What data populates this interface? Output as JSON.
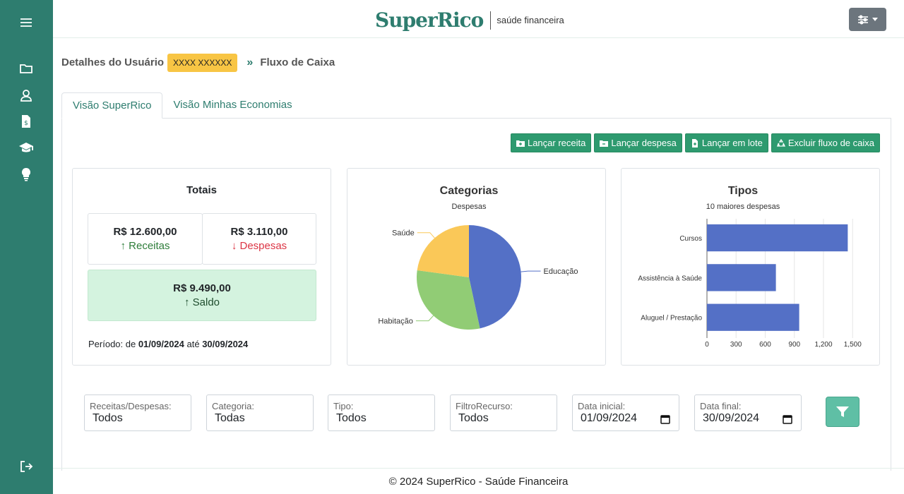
{
  "header": {
    "logo_text": "SuperRico",
    "logo_sub": "saúde financeira"
  },
  "breadcrumb": {
    "user_label": "Detalhes do Usuário",
    "user_name": "XXXX XXXXXX",
    "arrow": "»",
    "current": "Fluxo de Caixa"
  },
  "tabs": [
    {
      "label": "Visão SuperRico"
    },
    {
      "label": "Visão Minhas Economias"
    }
  ],
  "actions": [
    {
      "label": "Lançar receita"
    },
    {
      "label": "Lançar despesa"
    },
    {
      "label": "Lançar em lote"
    },
    {
      "label": "Excluir fluxo de caixa"
    }
  ],
  "totals": {
    "title": "Totais",
    "receitas_value": "R$ 12.600,00",
    "receitas_label": "↑ Receitas",
    "despesas_value": "R$ 3.110,00",
    "despesas_label": "↓ Despesas",
    "saldo_value": "R$ 9.490,00",
    "saldo_label": "↑ Saldo",
    "periodo_prefix": "Período: de ",
    "periodo_start": "01/09/2024",
    "periodo_mid": " até ",
    "periodo_end": "30/09/2024"
  },
  "colors": {
    "sidebar": "#2e7d6f",
    "accent": "#2e7d6f",
    "receita": "#2e7d3a",
    "despesa": "#dc3545",
    "saldo_bg": "#d4f3df",
    "bar": "#5470c6"
  },
  "chart_data": [
    {
      "type": "pie",
      "title": "Categorias",
      "subtitle": "Despesas",
      "labels": [
        "Educação",
        "Habitação",
        "Saúde"
      ],
      "values": [
        1450,
        950,
        710
      ],
      "colors": [
        "#5470c6",
        "#91cc75",
        "#fac858"
      ]
    },
    {
      "type": "bar",
      "orientation": "horizontal",
      "title": "Tipos",
      "subtitle": "10 maiores despesas",
      "categories": [
        "Cursos",
        "Assistência à Saúde",
        "Aluguel / Prestação"
      ],
      "values": [
        1450,
        710,
        950
      ],
      "xlim": [
        0,
        1600
      ],
      "xticks": [
        0,
        300,
        600,
        900,
        1200,
        1500
      ],
      "xtick_labels": [
        "0",
        "300",
        "600",
        "900",
        "1,200",
        "1,500"
      ],
      "color": "#5470c6"
    }
  ],
  "filters": [
    {
      "label": "Receitas/Despesas:",
      "value": "Todos"
    },
    {
      "label": "Categoria:",
      "value": "Todas"
    },
    {
      "label": "Tipo:",
      "value": "Todos"
    },
    {
      "label": "FiltroRecurso:",
      "value": "Todos"
    },
    {
      "label": "Data inicial:",
      "value": "01/09/2024"
    },
    {
      "label": "Data final:",
      "value": "30/09/2024"
    }
  ],
  "footer": {
    "text": "© 2024 SuperRico - Saúde Financeira"
  },
  "icons": [
    "menu-icon",
    "folder-icon",
    "user-icon",
    "invoice-icon",
    "graduation-cap-icon",
    "lightbulb-icon",
    "logout-icon",
    "sliders-icon",
    "filter-icon"
  ]
}
